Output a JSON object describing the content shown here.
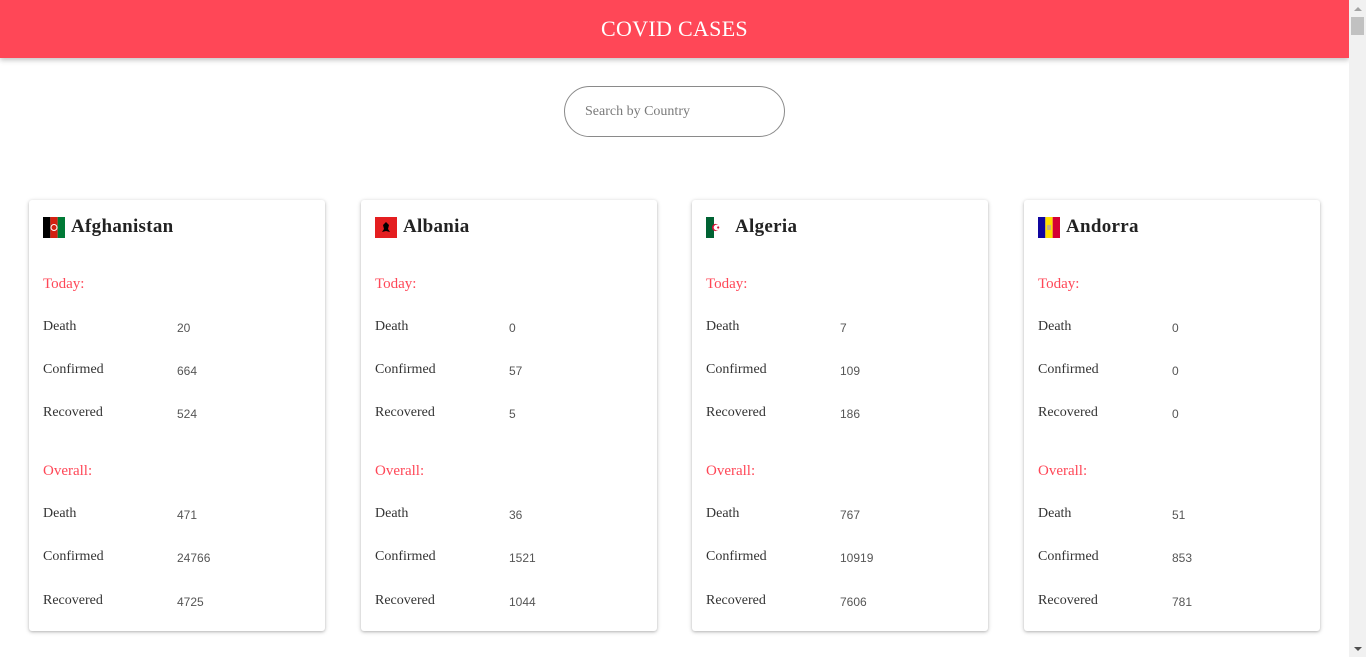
{
  "header": {
    "title": "COVID CASES"
  },
  "search": {
    "placeholder": "Search by Country",
    "value": ""
  },
  "colors": {
    "accent": "#ff4757",
    "header_bg": "#ff4757"
  },
  "cards": [
    {
      "country": "Afghanistan",
      "flag_icon": "afghanistan-flag-icon",
      "today_label": "Today:",
      "today": [
        {
          "label": "Death",
          "value": "20"
        },
        {
          "label": "Confirmed",
          "value": "664"
        },
        {
          "label": "Recovered",
          "value": "524"
        }
      ],
      "overall_label": "Overall:",
      "overall": [
        {
          "label": "Death",
          "value": "471"
        },
        {
          "label": "Confirmed",
          "value": "24766"
        },
        {
          "label": "Recovered",
          "value": "4725"
        }
      ]
    },
    {
      "country": "Albania",
      "flag_icon": "albania-flag-icon",
      "today_label": "Today:",
      "today": [
        {
          "label": "Death",
          "value": "0"
        },
        {
          "label": "Confirmed",
          "value": "57"
        },
        {
          "label": "Recovered",
          "value": "5"
        }
      ],
      "overall_label": "Overall:",
      "overall": [
        {
          "label": "Death",
          "value": "36"
        },
        {
          "label": "Confirmed",
          "value": "1521"
        },
        {
          "label": "Recovered",
          "value": "1044"
        }
      ]
    },
    {
      "country": "Algeria",
      "flag_icon": "algeria-flag-icon",
      "today_label": "Today:",
      "today": [
        {
          "label": "Death",
          "value": "7"
        },
        {
          "label": "Confirmed",
          "value": "109"
        },
        {
          "label": "Recovered",
          "value": "186"
        }
      ],
      "overall_label": "Overall:",
      "overall": [
        {
          "label": "Death",
          "value": "767"
        },
        {
          "label": "Confirmed",
          "value": "10919"
        },
        {
          "label": "Recovered",
          "value": "7606"
        }
      ]
    },
    {
      "country": "Andorra",
      "flag_icon": "andorra-flag-icon",
      "today_label": "Today:",
      "today": [
        {
          "label": "Death",
          "value": "0"
        },
        {
          "label": "Confirmed",
          "value": "0"
        },
        {
          "label": "Recovered",
          "value": "0"
        }
      ],
      "overall_label": "Overall:",
      "overall": [
        {
          "label": "Death",
          "value": "51"
        },
        {
          "label": "Confirmed",
          "value": "853"
        },
        {
          "label": "Recovered",
          "value": "781"
        }
      ]
    }
  ]
}
